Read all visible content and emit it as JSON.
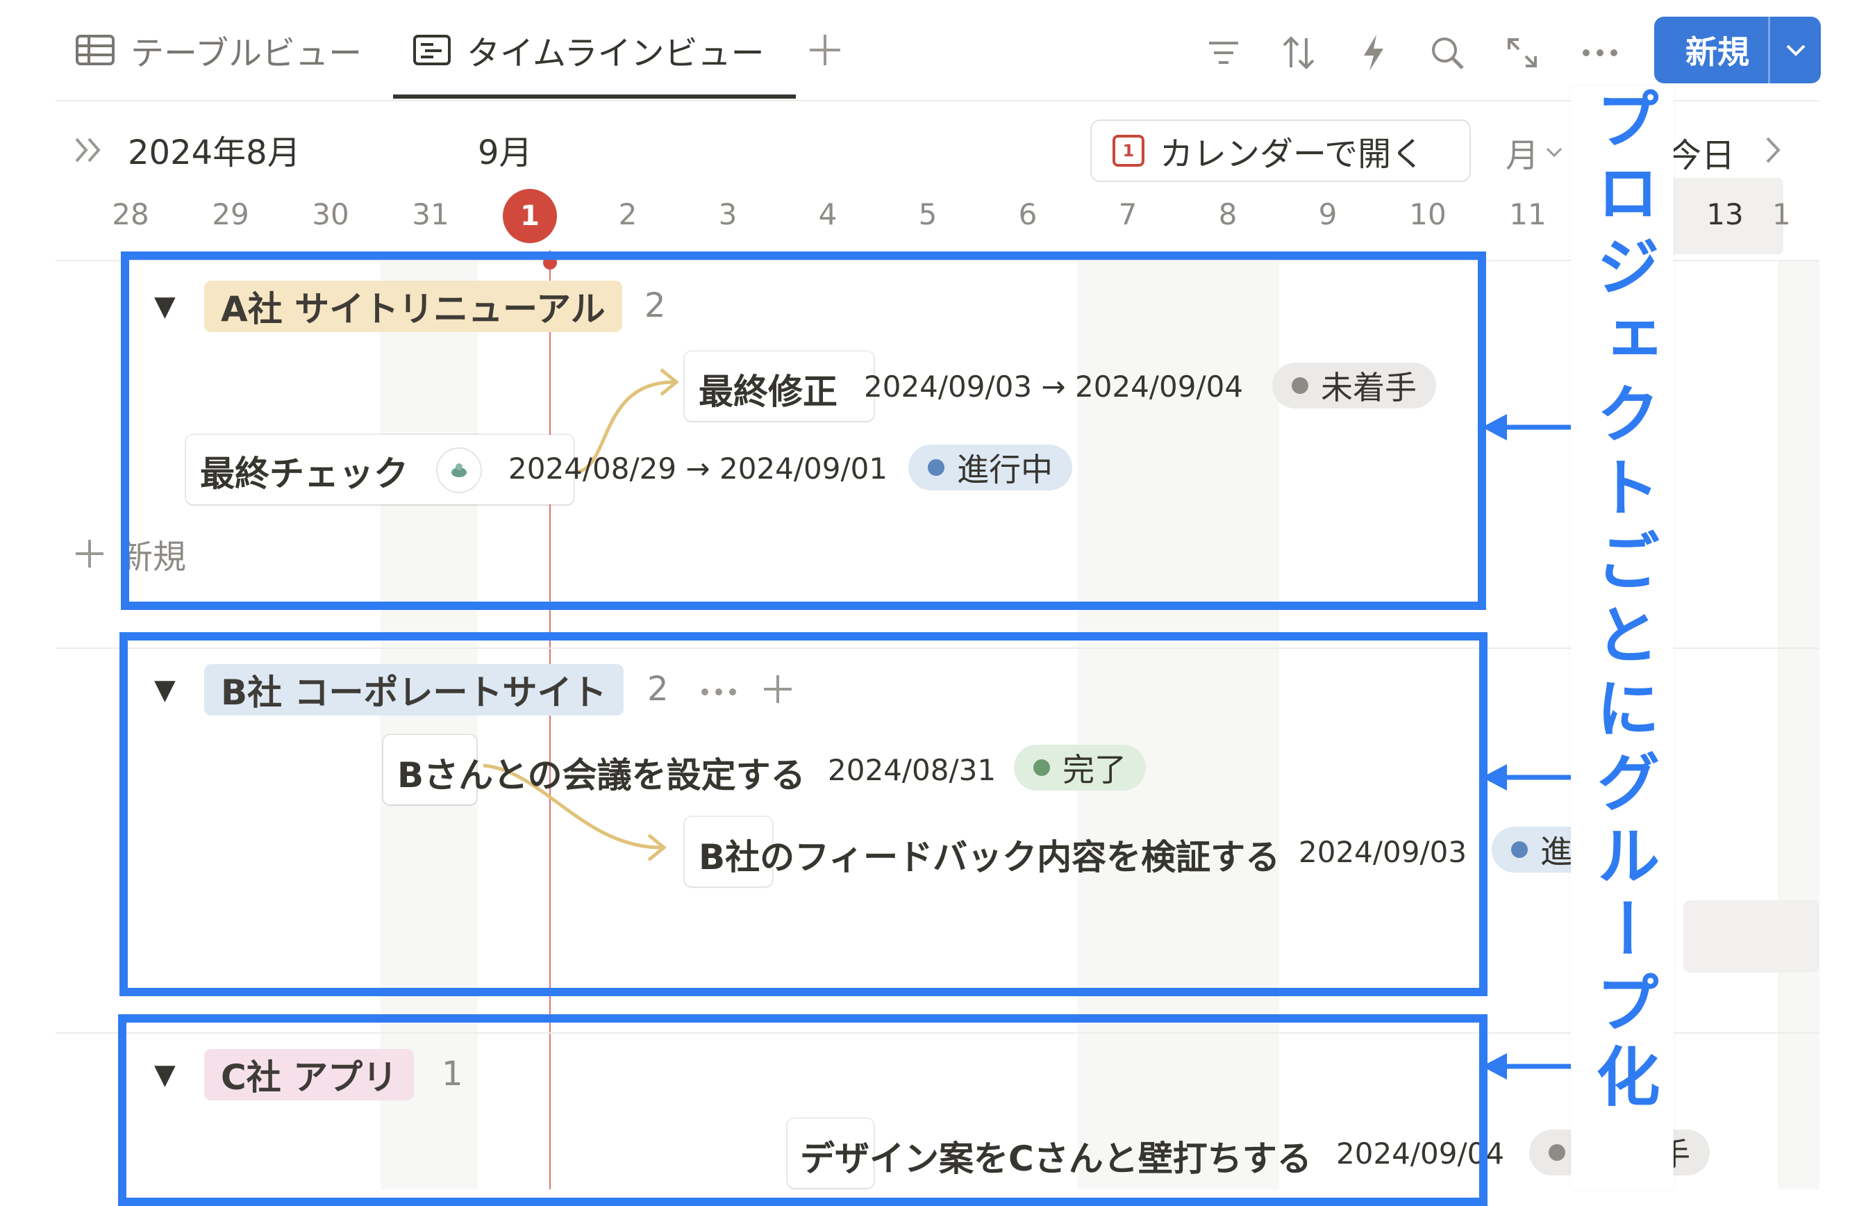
{
  "tabs": [
    {
      "label": "テーブルビュー",
      "icon": "table-icon"
    },
    {
      "label": "タイムラインビュー",
      "icon": "timeline-icon"
    }
  ],
  "toolbar": {
    "icons": [
      "filter-icon",
      "sort-icon",
      "automation-icon",
      "search-icon",
      "expand-icon",
      "more-icon"
    ],
    "new_label": "新規"
  },
  "timeline_header": {
    "month_primary": "2024年8月",
    "month_secondary": "9月",
    "open_calendar": "カレンダーで開く",
    "calendar_icon_digit": "1",
    "scale": "月",
    "today": "今日",
    "dates": [
      "28",
      "29",
      "30",
      "31",
      "1",
      "2",
      "3",
      "4",
      "5",
      "6",
      "7",
      "8",
      "9",
      "10",
      "11",
      "13",
      "1"
    ]
  },
  "groups": [
    {
      "name": "A社 サイトリニューアル",
      "count": "2",
      "color": "#f7e6c4",
      "new_label": "新規",
      "items": [
        {
          "title": "最終修正",
          "date": "2024/09/03 → 2024/09/04",
          "status": "未着手",
          "status_color": "#8e8b86",
          "status_bg": "#ebeae8"
        },
        {
          "title": "最終チェック",
          "date": "2024/08/29 → 2024/09/01",
          "status": "進行中",
          "status_color": "#5b86be",
          "status_bg": "#dde8f3"
        }
      ]
    },
    {
      "name": "B社 コーポレートサイト",
      "count": "2",
      "color": "#dde8f3",
      "items": [
        {
          "title": "Bさんとの会議を設定する",
          "date": "2024/08/31",
          "status": "完了",
          "status_color": "#6c9b6f",
          "status_bg": "#dfeede"
        },
        {
          "title": "B社のフィードバック内容を検証する",
          "date": "2024/09/03",
          "status": "進",
          "status_color": "#5b86be",
          "status_bg": "#dde8f3"
        }
      ]
    },
    {
      "name": "C社 アプリ",
      "count": "1",
      "color": "#f6e1ea",
      "items": [
        {
          "title": "デザイン案をCさんと壁打ちする",
          "date": "2024/09/04",
          "status": "手",
          "status_color": "#8e8b86",
          "status_bg": "#ebeae8"
        }
      ]
    }
  ],
  "annotation": {
    "text": "プロジェクトごとにグループ化",
    "color": "#2f7bf2"
  }
}
